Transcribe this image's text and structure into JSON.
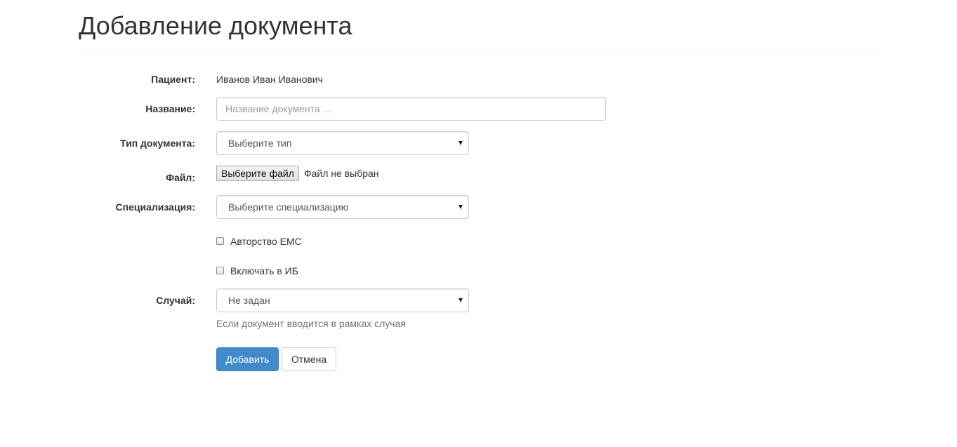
{
  "page": {
    "title": "Добавление документа"
  },
  "form": {
    "patient": {
      "label": "Пациент:",
      "value": "Иванов Иван Иванович"
    },
    "name": {
      "label": "Название:",
      "placeholder": "Название документа ...",
      "value": ""
    },
    "doc_type": {
      "label": "Тип документа:",
      "selected": "Выберите тип"
    },
    "file": {
      "label": "Файл:",
      "button_label": "Выберите файл",
      "status": "Файл не выбран"
    },
    "specialization": {
      "label": "Специализация:",
      "selected": "Выберите специализацию"
    },
    "authorship": {
      "label": "Авторство ЕМС",
      "checked": false
    },
    "include_ib": {
      "label": "Включать в ИБ",
      "checked": false
    },
    "case": {
      "label": "Случай:",
      "selected": "Не задан",
      "help": "Если документ вводится в рамках случая"
    }
  },
  "actions": {
    "submit_label": "Добавить",
    "cancel_label": "Отмена"
  },
  "colors": {
    "primary": "#428bca",
    "text": "#333333",
    "muted": "#737373",
    "border": "#cccccc"
  }
}
